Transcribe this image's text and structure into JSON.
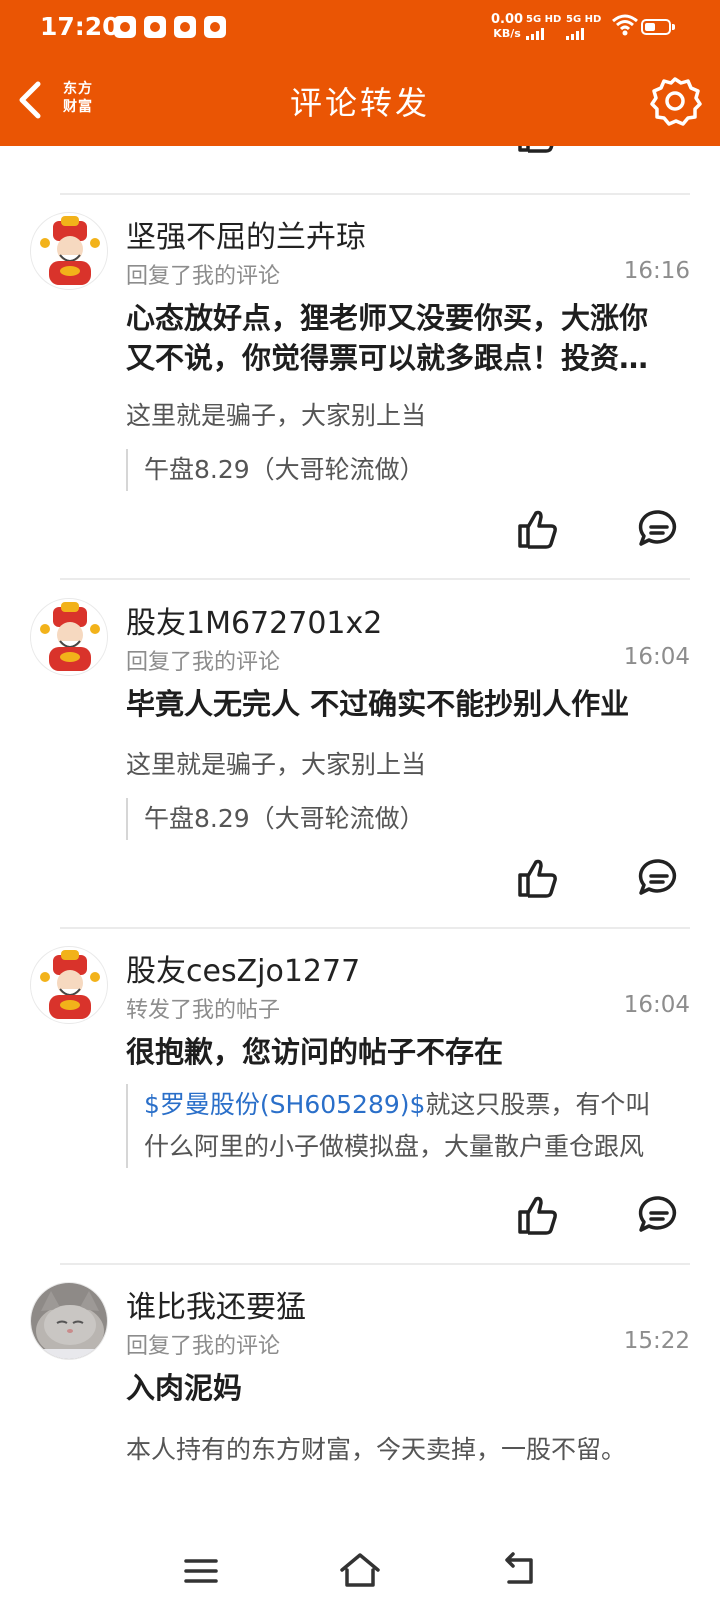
{
  "status_bar": {
    "time": "17:20",
    "net_speed": "0.00",
    "net_unit": "KB/s",
    "sim1_label": "5G HD",
    "sim2_label": "5G HD"
  },
  "header": {
    "title": "评论转发",
    "brand_line1": "东方",
    "brand_line2": "财富"
  },
  "colors": {
    "brand": "#ea5504",
    "link": "#2a6fc9",
    "muted": "#8d8d8d"
  },
  "items": [
    {
      "username": "坚强不屈的兰卉琼",
      "action": "回复了我的评论",
      "time": "16:16",
      "comment": "心态放好点，狸老师又没要你买，大涨你又不说，你觉得票可以就多跟点！投资需谨慎",
      "my_comment": "这里就是骗子，大家别上当",
      "quote": "午盘8.29（大哥轮流做）"
    },
    {
      "username": "股友1M672701x2",
      "action": "回复了我的评论",
      "time": "16:04",
      "comment": "毕竟人无完人 不过确实不能抄别人作业",
      "my_comment": "这里就是骗子，大家别上当",
      "quote": "午盘8.29（大哥轮流做）"
    },
    {
      "username": "股友cesZjo1277",
      "action": "转发了我的帖子",
      "time": "16:04",
      "comment": "很抱歉，您访问的帖子不存在",
      "quote_link": "$罗曼股份(SH605289)$",
      "quote_rest": "就这只股票，有个叫什么阿里的小子做模拟盘，大量散户重仓跟风"
    },
    {
      "username": "谁比我还要猛",
      "action": "回复了我的评论",
      "time": "15:22",
      "comment": "入肉泥妈",
      "my_comment": "本人持有的东方财富，今天卖掉，一股不留。"
    }
  ]
}
